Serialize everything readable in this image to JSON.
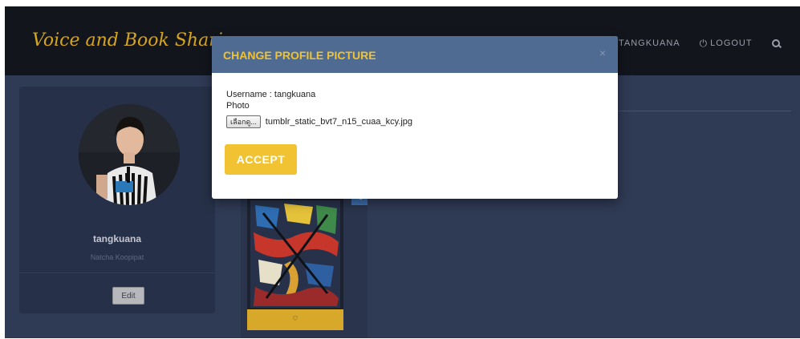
{
  "navbar": {
    "brand": "Voice and Book Sharing",
    "user_label": "TANGKUANA",
    "logout_label": "LOGOUT"
  },
  "profile": {
    "username": "tangkuana",
    "full_name": "Natcha Koopipat",
    "edit_label": "Edit"
  },
  "modal": {
    "title": "CHANGE PROFILE PICTURE",
    "close_symbol": "×",
    "username_line": "Username : tangkuana",
    "photo_label": "Photo",
    "file_button_label": "เลือกดู...",
    "file_name": "tumblr_static_bvt7_n15_cuaa_kcy.jpg",
    "accept_label": "ACCEPT"
  },
  "colors": {
    "accent_yellow": "#f1c232",
    "modal_header": "#4f6b91",
    "navbar_bg": "#12151c",
    "page_bg": "#2c3750"
  },
  "icons": {
    "user": "user-icon",
    "logout": "power-icon",
    "search": "search-icon",
    "edit_book": "pencil-icon",
    "close": "close-icon"
  }
}
